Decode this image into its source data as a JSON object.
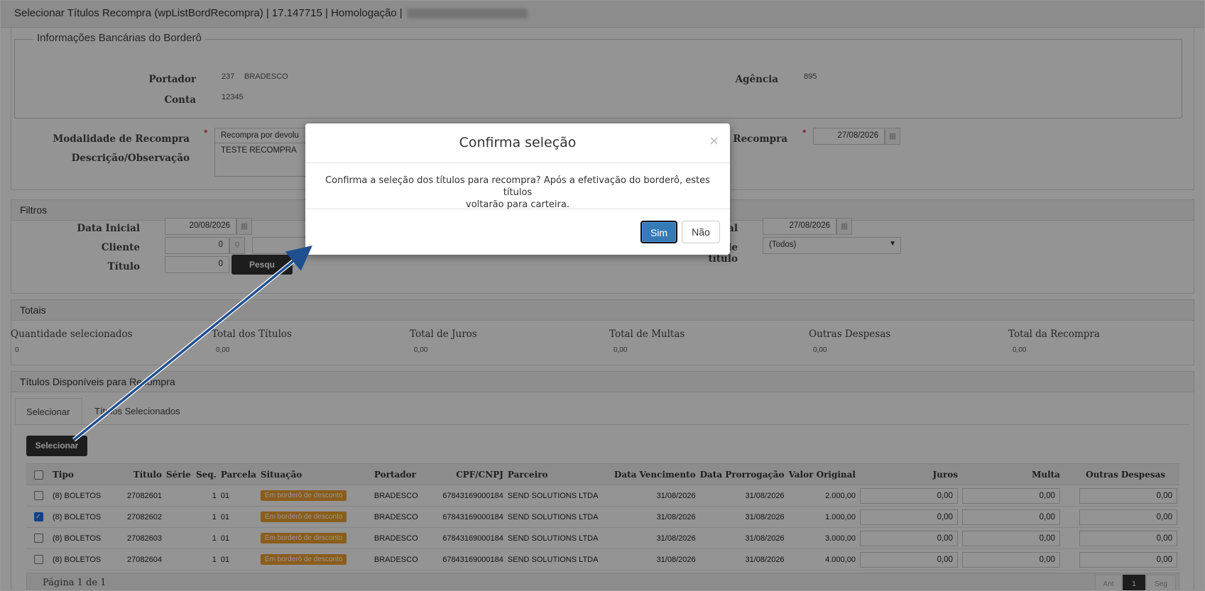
{
  "window": {
    "title": "Selecionar Títulos Recompra (wpListBordRecompra) | 17.147715 | Homologação |"
  },
  "bank_info": {
    "legend": "Informações Bancárias do Borderô",
    "portador_label": "Portador",
    "portador_code": "237",
    "portador_name": "BRADESCO",
    "conta_label": "Conta",
    "conta_value": "12345",
    "agencia_label": "Agência",
    "agencia_value": "895"
  },
  "form": {
    "modalidade_label": "Modalidade de Recompra",
    "modalidade_value": "Recompra por devolu",
    "descricao_label": "Descrição/Observação",
    "descricao_value": "TESTE RECOMPRA",
    "data_recompra_label": "a Recompra",
    "data_recompra_value": "27/08/2026",
    "required_mark": "*"
  },
  "filtros": {
    "title": "Filtros",
    "data_inicial_label": "Data Inicial",
    "data_inicial_value": "20/08/2026",
    "cliente_label": "Cliente",
    "cliente_value": "0",
    "titulo_label": "Título",
    "titulo_value": "0",
    "pesquisar_label": "Pesqu",
    "data_final_label": "al",
    "data_final_value": "27/08/2026",
    "tipo_titulo_label": "Tipo de título",
    "tipo_titulo_value": "(Todos)"
  },
  "totais": {
    "title": "Totais",
    "columns": [
      {
        "label": "Quantidade selecionados",
        "value": "0"
      },
      {
        "label": "Total dos Títulos",
        "value": "0,00"
      },
      {
        "label": "Total de Juros",
        "value": "0,00"
      },
      {
        "label": "Total de Multas",
        "value": "0,00"
      },
      {
        "label": "Outras Despesas",
        "value": "0,00"
      },
      {
        "label": "Total da Recompra",
        "value": "0,00"
      }
    ]
  },
  "titulos": {
    "title": "Títulos Disponíveis para Recompra",
    "tabs": [
      "Selecionar",
      "Títulos Selecionados"
    ],
    "selecionar_button": "Selecionar",
    "headers": [
      "Tipo",
      "Título",
      "Série",
      "Seq.",
      "Parcela",
      "Situação",
      "Portador",
      "CPF/CNPJ",
      "Parceiro",
      "Data Vencimento",
      "Data Prorrogação",
      "Valor Original",
      "Juros",
      "Multa",
      "Outras Despesas"
    ],
    "rows": [
      {
        "checked": false,
        "tipo": "(8) BOLETOS",
        "titulo": "27082601",
        "serie": "",
        "seq": "1",
        "parcela": "01",
        "situacao": "Em borderô de desconto",
        "portador": "BRADESCO",
        "cnpj": "67843169000184",
        "parceiro": "SEND SOLUTIONS LTDA",
        "vencimento": "31/08/2026",
        "prorrogacao": "31/08/2026",
        "valor": "2.000,00",
        "juros": "0,00",
        "multa": "0,00",
        "outras": "0,00"
      },
      {
        "checked": true,
        "tipo": "(8) BOLETOS",
        "titulo": "27082602",
        "serie": "",
        "seq": "1",
        "parcela": "01",
        "situacao": "Em borderô de desconto",
        "portador": "BRADESCO",
        "cnpj": "67843169000184",
        "parceiro": "SEND SOLUTIONS LTDA",
        "vencimento": "31/08/2026",
        "prorrogacao": "31/08/2026",
        "valor": "1.000,00",
        "juros": "0,00",
        "multa": "0,00",
        "outras": "0,00"
      },
      {
        "checked": false,
        "tipo": "(8) BOLETOS",
        "titulo": "27082603",
        "serie": "",
        "seq": "1",
        "parcela": "01",
        "situacao": "Em borderô de desconto",
        "portador": "BRADESCO",
        "cnpj": "67843169000184",
        "parceiro": "SEND SOLUTIONS LTDA",
        "vencimento": "31/08/2026",
        "prorrogacao": "31/08/2026",
        "valor": "3.000,00",
        "juros": "0,00",
        "multa": "0,00",
        "outras": "0,00"
      },
      {
        "checked": false,
        "tipo": "(8) BOLETOS",
        "titulo": "27082604",
        "serie": "",
        "seq": "1",
        "parcela": "01",
        "situacao": "Em borderô de desconto",
        "portador": "BRADESCO",
        "cnpj": "67843169000184",
        "parceiro": "SEND SOLUTIONS LTDA",
        "vencimento": "31/08/2026",
        "prorrogacao": "31/08/2026",
        "valor": "4.000,00",
        "juros": "0,00",
        "multa": "0,00",
        "outras": "0,00"
      }
    ],
    "pager": {
      "label": "Página 1 de 1",
      "prev": "Ant",
      "current": "1",
      "next": "Seg"
    }
  },
  "modal": {
    "title": "Confirma seleção",
    "close_glyph": "×",
    "message_line1": "Confirma a seleção dos títulos para recompra? Após a efetivação do borderô, estes títulos",
    "message_line2": "voltarão para carteira.",
    "yes_label": "Sim",
    "no_label": "Não"
  },
  "colors": {
    "accent": "#337ab7",
    "badge": "#f0a030",
    "arrow": "#1f4f8f"
  }
}
